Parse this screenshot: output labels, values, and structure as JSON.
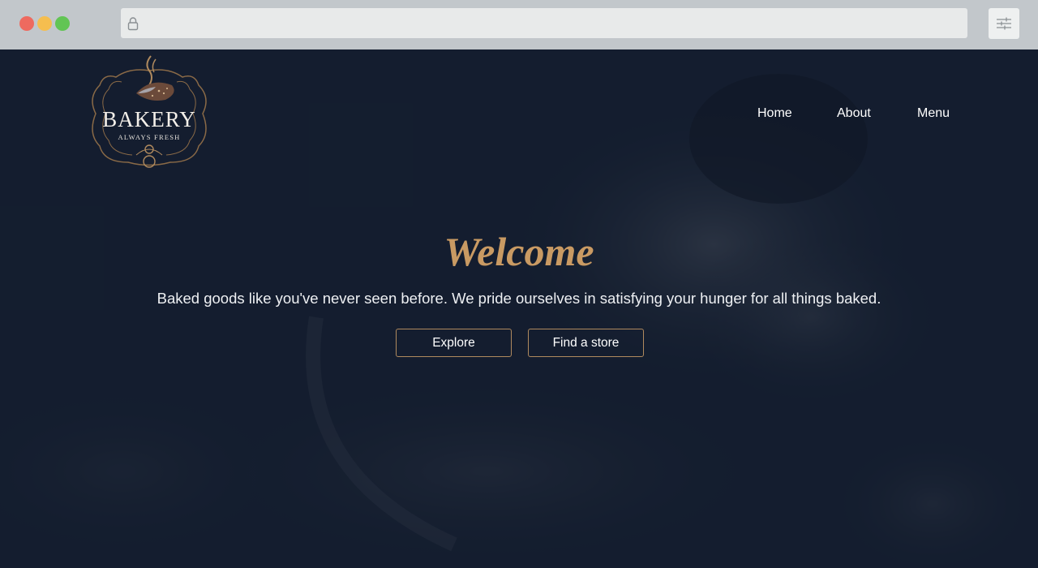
{
  "browser": {
    "traffic_lights": {
      "close": "#ee6a5f",
      "minimize": "#f5be4f",
      "maximize": "#62c554"
    },
    "address_bar": {
      "value": "",
      "icon": "lock-icon"
    },
    "settings_icon": "sliders-icon"
  },
  "site": {
    "logo": {
      "name": "BAKERY",
      "tagline": "ALWAYS FRESH"
    },
    "nav": [
      {
        "label": "Home"
      },
      {
        "label": "About"
      },
      {
        "label": "Menu"
      }
    ],
    "hero": {
      "title": "Welcome",
      "subtitle": "Baked goods like you've never seen before. We pride ourselves in satisfying your hunger for all things baked.",
      "buttons": [
        {
          "label": "Explore"
        },
        {
          "label": "Find a store"
        }
      ]
    },
    "colors": {
      "background": "#151f30",
      "accent": "#c99a63",
      "button_border": "#b08a5e",
      "text": "#ffffff"
    }
  }
}
